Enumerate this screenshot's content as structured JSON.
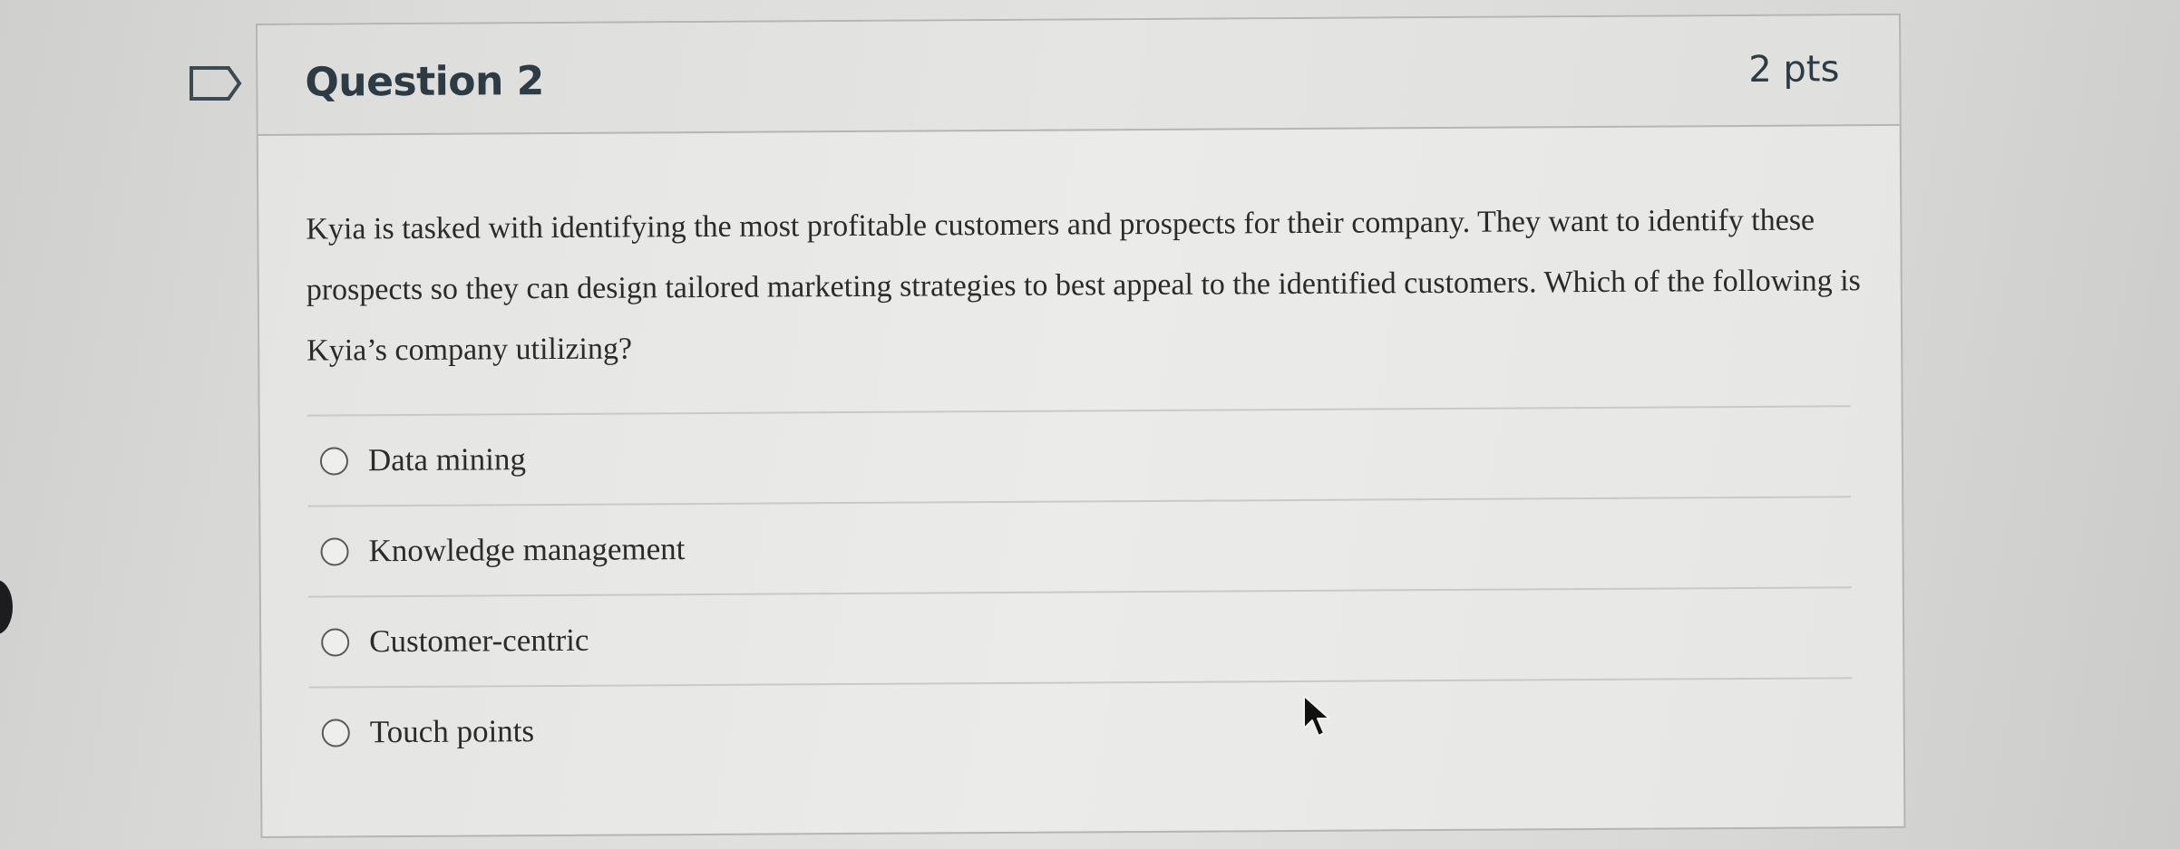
{
  "question": {
    "title": "Question 2",
    "points": "2 pts",
    "text": "Kyia is tasked with identifying the most profitable customers and prospects for their company. They want to identify these prospects so they can design tailored marketing strategies to best appeal to the identified customers. Which of the following is Kyia’s company utilizing?"
  },
  "answers": [
    {
      "label": "Data mining",
      "selected": false
    },
    {
      "label": "Knowledge management",
      "selected": false
    },
    {
      "label": "Customer-centric",
      "selected": false
    },
    {
      "label": "Touch points",
      "selected": false
    }
  ],
  "icons": {
    "flag": "bookmark-flag-icon",
    "cursor": "mouse-pointer-icon"
  },
  "colors": {
    "title_text": "#2d3b45",
    "body_text": "#2b2b2b",
    "border": "#b5b5b3"
  }
}
